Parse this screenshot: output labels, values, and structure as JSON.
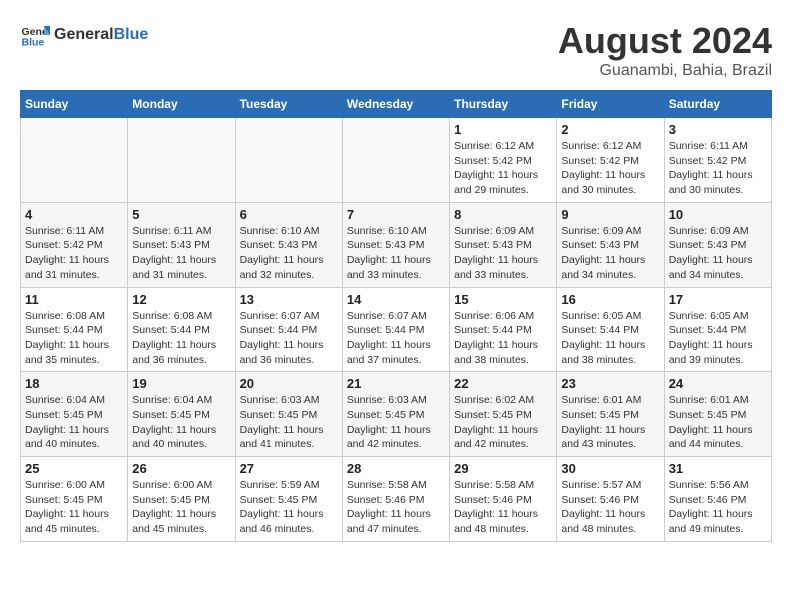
{
  "header": {
    "logo_general": "General",
    "logo_blue": "Blue",
    "title": "August 2024",
    "location": "Guanambi, Bahia, Brazil"
  },
  "weekdays": [
    "Sunday",
    "Monday",
    "Tuesday",
    "Wednesday",
    "Thursday",
    "Friday",
    "Saturday"
  ],
  "weeks": [
    [
      {
        "day": "",
        "detail": ""
      },
      {
        "day": "",
        "detail": ""
      },
      {
        "day": "",
        "detail": ""
      },
      {
        "day": "",
        "detail": ""
      },
      {
        "day": "1",
        "detail": "Sunrise: 6:12 AM\nSunset: 5:42 PM\nDaylight: 11 hours\nand 29 minutes."
      },
      {
        "day": "2",
        "detail": "Sunrise: 6:12 AM\nSunset: 5:42 PM\nDaylight: 11 hours\nand 30 minutes."
      },
      {
        "day": "3",
        "detail": "Sunrise: 6:11 AM\nSunset: 5:42 PM\nDaylight: 11 hours\nand 30 minutes."
      }
    ],
    [
      {
        "day": "4",
        "detail": "Sunrise: 6:11 AM\nSunset: 5:42 PM\nDaylight: 11 hours\nand 31 minutes."
      },
      {
        "day": "5",
        "detail": "Sunrise: 6:11 AM\nSunset: 5:43 PM\nDaylight: 11 hours\nand 31 minutes."
      },
      {
        "day": "6",
        "detail": "Sunrise: 6:10 AM\nSunset: 5:43 PM\nDaylight: 11 hours\nand 32 minutes."
      },
      {
        "day": "7",
        "detail": "Sunrise: 6:10 AM\nSunset: 5:43 PM\nDaylight: 11 hours\nand 33 minutes."
      },
      {
        "day": "8",
        "detail": "Sunrise: 6:09 AM\nSunset: 5:43 PM\nDaylight: 11 hours\nand 33 minutes."
      },
      {
        "day": "9",
        "detail": "Sunrise: 6:09 AM\nSunset: 5:43 PM\nDaylight: 11 hours\nand 34 minutes."
      },
      {
        "day": "10",
        "detail": "Sunrise: 6:09 AM\nSunset: 5:43 PM\nDaylight: 11 hours\nand 34 minutes."
      }
    ],
    [
      {
        "day": "11",
        "detail": "Sunrise: 6:08 AM\nSunset: 5:44 PM\nDaylight: 11 hours\nand 35 minutes."
      },
      {
        "day": "12",
        "detail": "Sunrise: 6:08 AM\nSunset: 5:44 PM\nDaylight: 11 hours\nand 36 minutes."
      },
      {
        "day": "13",
        "detail": "Sunrise: 6:07 AM\nSunset: 5:44 PM\nDaylight: 11 hours\nand 36 minutes."
      },
      {
        "day": "14",
        "detail": "Sunrise: 6:07 AM\nSunset: 5:44 PM\nDaylight: 11 hours\nand 37 minutes."
      },
      {
        "day": "15",
        "detail": "Sunrise: 6:06 AM\nSunset: 5:44 PM\nDaylight: 11 hours\nand 38 minutes."
      },
      {
        "day": "16",
        "detail": "Sunrise: 6:05 AM\nSunset: 5:44 PM\nDaylight: 11 hours\nand 38 minutes."
      },
      {
        "day": "17",
        "detail": "Sunrise: 6:05 AM\nSunset: 5:44 PM\nDaylight: 11 hours\nand 39 minutes."
      }
    ],
    [
      {
        "day": "18",
        "detail": "Sunrise: 6:04 AM\nSunset: 5:45 PM\nDaylight: 11 hours\nand 40 minutes."
      },
      {
        "day": "19",
        "detail": "Sunrise: 6:04 AM\nSunset: 5:45 PM\nDaylight: 11 hours\nand 40 minutes."
      },
      {
        "day": "20",
        "detail": "Sunrise: 6:03 AM\nSunset: 5:45 PM\nDaylight: 11 hours\nand 41 minutes."
      },
      {
        "day": "21",
        "detail": "Sunrise: 6:03 AM\nSunset: 5:45 PM\nDaylight: 11 hours\nand 42 minutes."
      },
      {
        "day": "22",
        "detail": "Sunrise: 6:02 AM\nSunset: 5:45 PM\nDaylight: 11 hours\nand 42 minutes."
      },
      {
        "day": "23",
        "detail": "Sunrise: 6:01 AM\nSunset: 5:45 PM\nDaylight: 11 hours\nand 43 minutes."
      },
      {
        "day": "24",
        "detail": "Sunrise: 6:01 AM\nSunset: 5:45 PM\nDaylight: 11 hours\nand 44 minutes."
      }
    ],
    [
      {
        "day": "25",
        "detail": "Sunrise: 6:00 AM\nSunset: 5:45 PM\nDaylight: 11 hours\nand 45 minutes."
      },
      {
        "day": "26",
        "detail": "Sunrise: 6:00 AM\nSunset: 5:45 PM\nDaylight: 11 hours\nand 45 minutes."
      },
      {
        "day": "27",
        "detail": "Sunrise: 5:59 AM\nSunset: 5:45 PM\nDaylight: 11 hours\nand 46 minutes."
      },
      {
        "day": "28",
        "detail": "Sunrise: 5:58 AM\nSunset: 5:46 PM\nDaylight: 11 hours\nand 47 minutes."
      },
      {
        "day": "29",
        "detail": "Sunrise: 5:58 AM\nSunset: 5:46 PM\nDaylight: 11 hours\nand 48 minutes."
      },
      {
        "day": "30",
        "detail": "Sunrise: 5:57 AM\nSunset: 5:46 PM\nDaylight: 11 hours\nand 48 minutes."
      },
      {
        "day": "31",
        "detail": "Sunrise: 5:56 AM\nSunset: 5:46 PM\nDaylight: 11 hours\nand 49 minutes."
      }
    ]
  ]
}
